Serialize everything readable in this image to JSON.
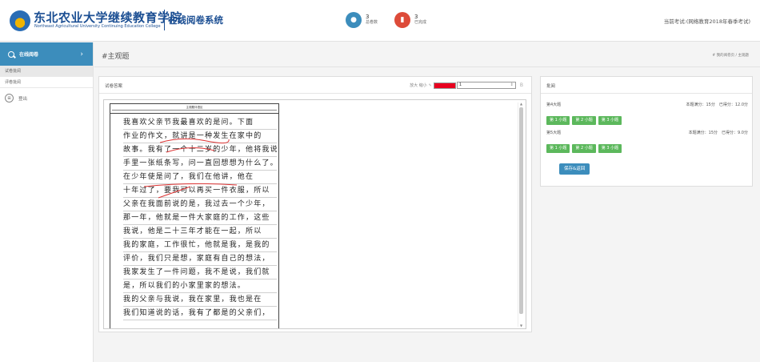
{
  "header": {
    "school_cn": "东北农业大学继续教育学院",
    "school_en": "Northeast Agricultural University Continuing Education College",
    "system_title": "在线阅卷系统",
    "stats": [
      {
        "count": "3",
        "label": "总卷数",
        "color": "#3c8dbc"
      },
      {
        "count": "3",
        "label": "已完成",
        "color": "#dd4b39"
      }
    ],
    "current_exam": "当前考试:(网络教育2018年春季考试)"
  },
  "sidebar": {
    "head_label": "在线阅卷",
    "items": [
      {
        "label": "试卷批阅"
      },
      {
        "label": "评卷批阅"
      }
    ],
    "logout_label": "登出"
  },
  "page": {
    "title": "#主观题",
    "breadcrumb": "# 我的阅卷页 / 主观题"
  },
  "paper": {
    "title": "试卷答案",
    "tools_label": "放大 缩小",
    "size_value": "1",
    "bold_label": "B",
    "sheet_title": "主观题评语区",
    "handwriting": [
      "我喜欢父亲节我最喜欢的是问。下面",
      "作业的作文，就讲是一种发生在家中的",
      "故事。我有了一个十二岁的少年，他将我说",
      "手里一张纸条写，问一直回想想为什么了。",
      "在少年使是问了，我们在他讲，他在",
      "十年过了，要我可以再买一件衣服，所以",
      "父亲在我面前说的是，我过去一个少年，",
      "那一年，他就是一件大家庭的工作，这些",
      "我说，他是二十三年才能在一起，所以",
      "我的家庭，工作很忙，他就是我，是我的",
      "评价，我们只是想，家庭有自己的想法，",
      "我家发生了一件问题，我不是说，我们就",
      "是，所以我们的小家里家的想法。",
      "我的父亲与我说，我在家里，我也是在",
      "我们知道说的话，我有了都是的父亲们，"
    ]
  },
  "scoring": {
    "title": "批阅",
    "questions": [
      {
        "name": "第4大题",
        "summary": "本题满分：15分　已得分：12.0分",
        "subs": [
          "第 1 小题",
          "第 2 小题",
          "第 3 小题"
        ]
      },
      {
        "name": "第5大题",
        "summary": "本题满分：15分　已得分：9.0分",
        "subs": [
          "第 1 小题",
          "第 2 小题",
          "第 3 小题"
        ]
      }
    ],
    "save_label": "保存&返回"
  }
}
